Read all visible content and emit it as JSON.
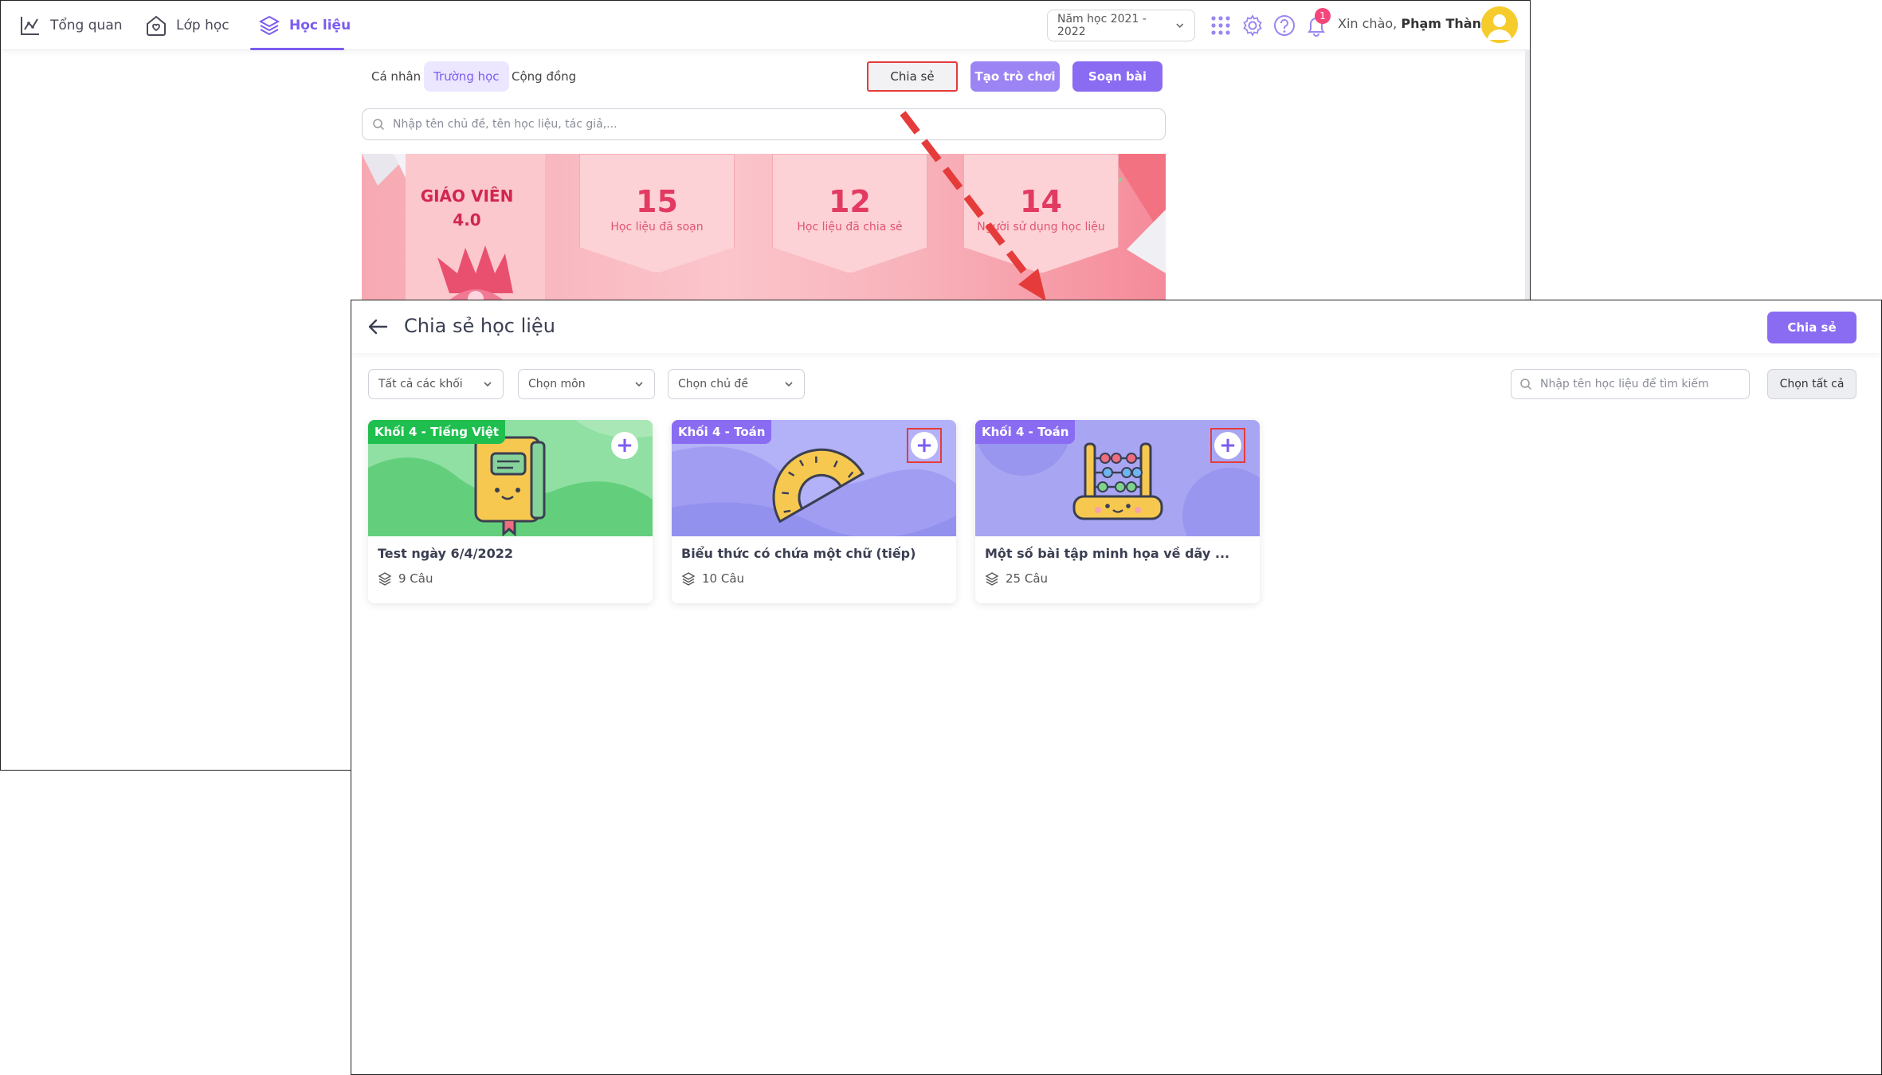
{
  "nav": {
    "items": [
      {
        "label": "Tổng quan"
      },
      {
        "label": "Lớp học"
      },
      {
        "label": "Học liệu"
      }
    ],
    "year_select": "Năm học 2021 - 2022",
    "notif_count": "1",
    "greeting": "Xin chào,",
    "user_name": "Phạm Thành"
  },
  "tabs": [
    {
      "label": "Cá nhân"
    },
    {
      "label": "Trường học"
    },
    {
      "label": "Cộng đồng"
    }
  ],
  "actions": {
    "share": "Chia sẻ",
    "create_game": "Tạo trò chơi",
    "compose": "Soạn bài"
  },
  "search_top": {
    "placeholder": "Nhập tên chủ đề, tên học liệu, tác giả,..."
  },
  "banner": {
    "title_line1": "GIÁO VIÊN",
    "title_line2": "4.0",
    "stats": [
      {
        "value": "15",
        "label": "Học liệu đã soạn"
      },
      {
        "value": "12",
        "label": "Học liệu đã chia sẻ"
      },
      {
        "value": "14",
        "label": "Người sử dụng học liệu"
      }
    ]
  },
  "share_panel": {
    "title": "Chia sẻ học liệu",
    "share_button": "Chia sẻ",
    "filters": [
      "Tất cả các khối",
      "Chọn môn",
      "Chọn chủ đề"
    ],
    "search_placeholder": "Nhập tên học liệu để tìm kiếm",
    "select_all": "Chọn tất cả",
    "cards": [
      {
        "tag": "Khối 4 - Tiếng Việt",
        "title": "Test ngày 6/4/2022",
        "count": "9 Câu",
        "tag_color": "#1fbf4f",
        "bg_color": "#8fe0a2"
      },
      {
        "tag": "Khối 4 - Toán",
        "title": "Biểu thức có chứa một chữ (tiếp)",
        "count": "10 Câu",
        "tag_color": "#8a6cf2",
        "bg_color": "#b3b1f7"
      },
      {
        "tag": "Khối 4 - Toán",
        "title": "Một số bài tập minh họa về dãy ...",
        "count": "25 Câu",
        "tag_color": "#8a6cf2",
        "bg_color": "#a8a6f3"
      }
    ]
  },
  "colors": {
    "accent": "#7b5cf0",
    "highlight": "#e53b3b",
    "banner_pink": "#f7a9b2"
  }
}
